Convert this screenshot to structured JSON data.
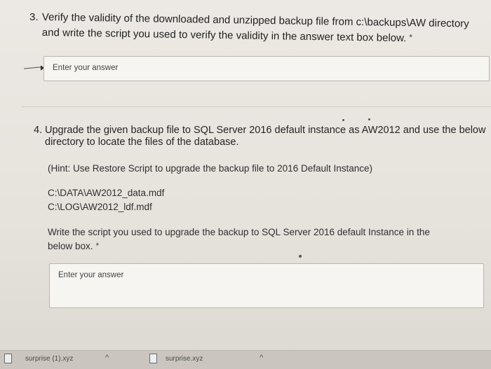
{
  "q3": {
    "number": "3.",
    "line1": "Verify the validity of the downloaded and unzipped backup file from c:\\backups\\AW directory",
    "line2": "and write the script you used to verify the validity in the answer text box below.",
    "required_mark": "*",
    "answer_placeholder": "Enter your answer"
  },
  "q4": {
    "number": "4.",
    "line1": "Upgrade the given backup file to SQL Server 2016 default instance as AW2012 and use the below",
    "line2": "directory to locate the files of the database.",
    "hint": "(Hint: Use Restore Script to upgrade the backup file to 2016 Default Instance)",
    "path1": "C:\\DATA\\AW2012_data.mdf",
    "path2": "C:\\LOG\\AW2012_ldf.mdf",
    "sub_line1": "Write the script you used to upgrade the backup to SQL Server 2016 default Instance in the",
    "sub_line2": "below box.",
    "required_mark": "*",
    "answer_placeholder": "Enter your answer"
  },
  "downloads": [
    {
      "name": "surprise (1).xyz",
      "icon": "file-icon"
    },
    {
      "name": "surprise.xyz",
      "icon": "file-icon"
    }
  ]
}
